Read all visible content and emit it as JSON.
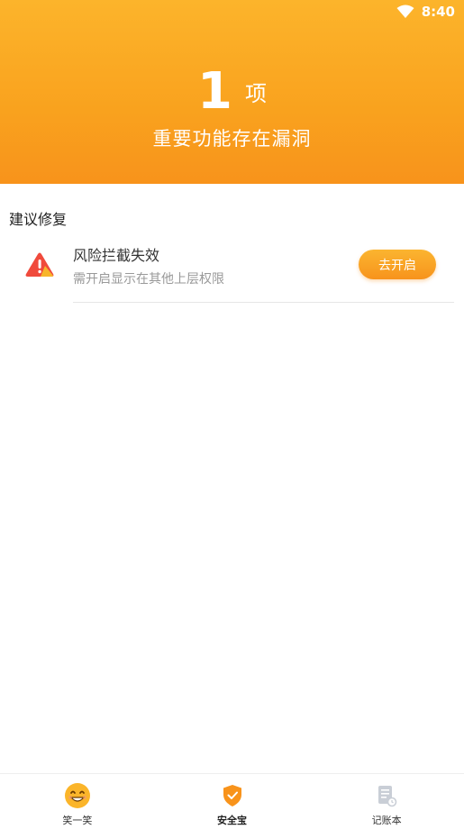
{
  "status_bar": {
    "time": "8:40",
    "wifi_icon": "wifi-icon"
  },
  "header": {
    "count": "1",
    "unit": "项",
    "subtitle": "重要功能存在漏洞",
    "gradient_colors": [
      "#fcb42b",
      "#f8931b"
    ]
  },
  "section": {
    "title": "建议修复"
  },
  "issues": [
    {
      "icon": "warning-icon",
      "title": "风险拦截失效",
      "description": "需开启显示在其他上层权限",
      "action_label": "去开启"
    }
  ],
  "tab_bar": {
    "tabs": [
      {
        "label": "笑一笑",
        "icon": "smile-icon",
        "active": false
      },
      {
        "label": "安全宝",
        "icon": "shield-icon",
        "active": true
      },
      {
        "label": "记账本",
        "icon": "notebook-icon",
        "active": false
      }
    ]
  },
  "accent_color": "#f8931b"
}
